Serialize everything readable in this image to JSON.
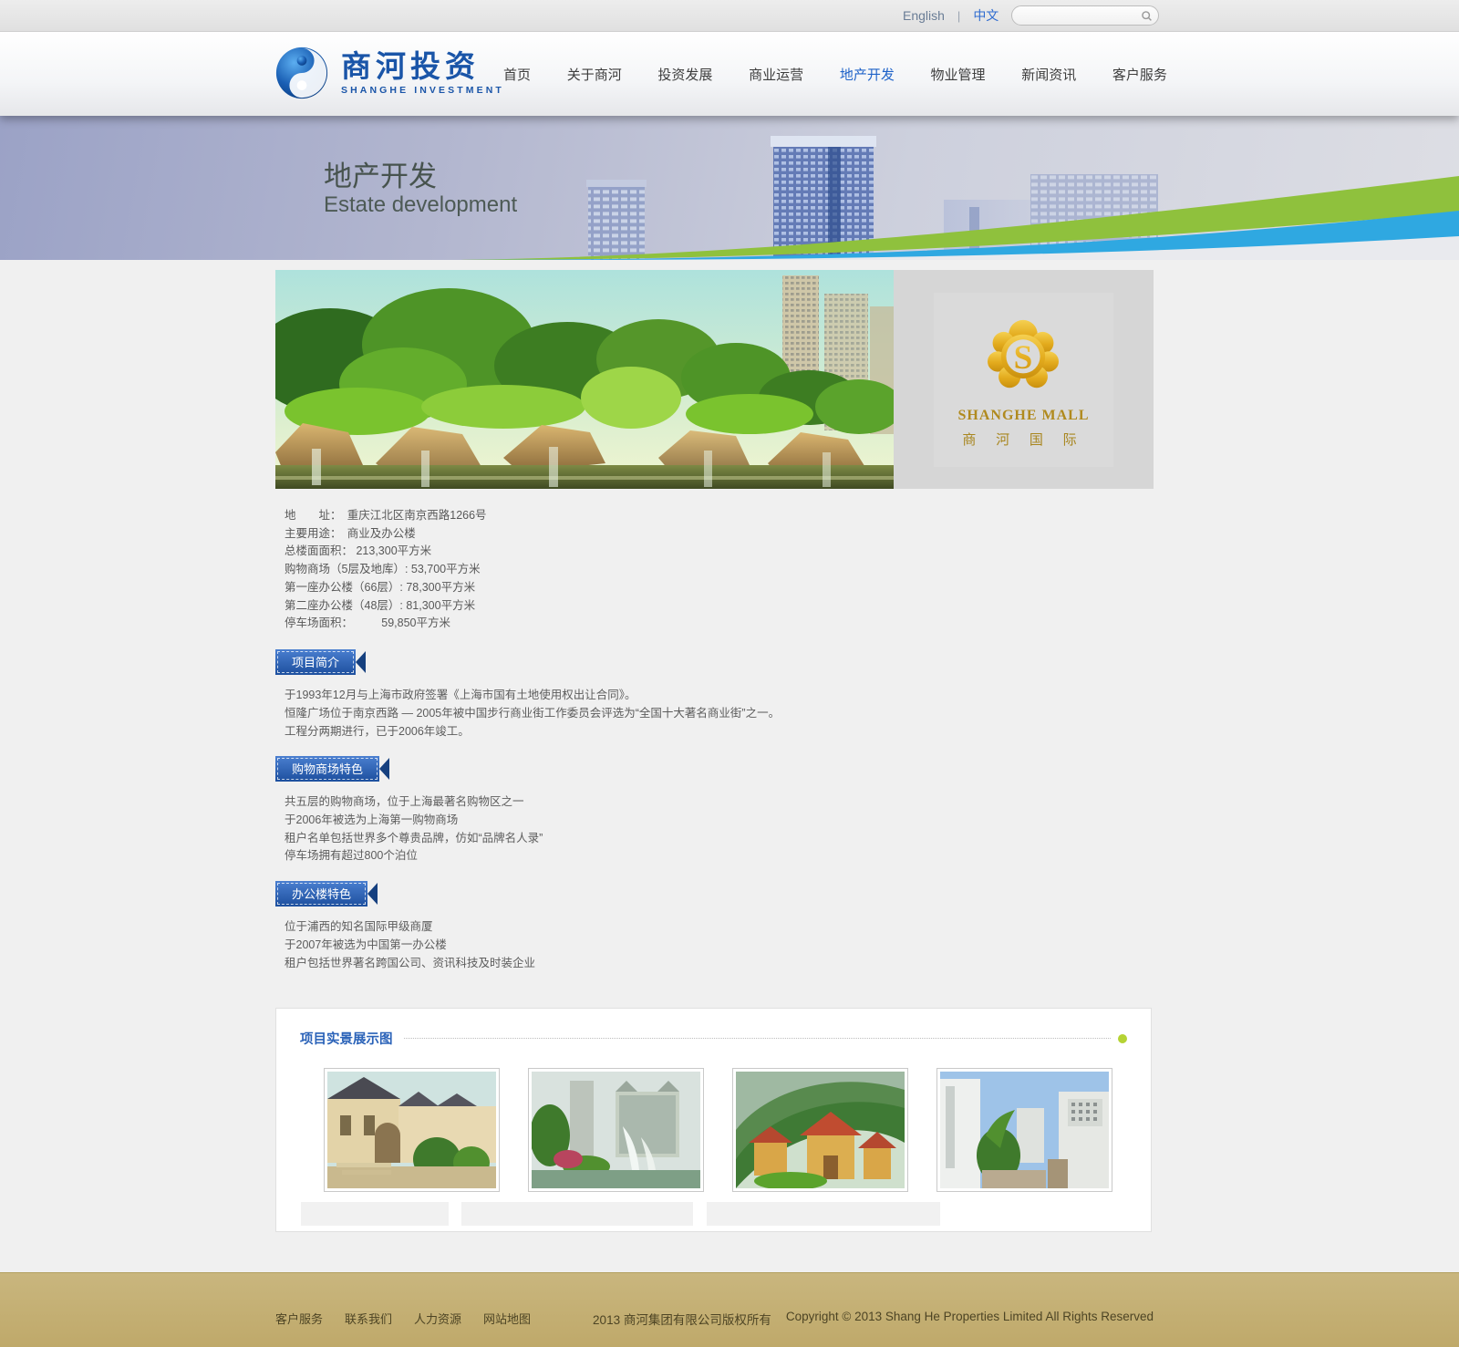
{
  "topbar": {
    "lang_english": "English",
    "lang_divider": "|",
    "lang_chinese": "中文",
    "search_placeholder": ""
  },
  "header": {
    "logo_zh": "商河投资",
    "logo_en": "SHANGHE INVESTMENT",
    "nav": [
      {
        "label": "首页"
      },
      {
        "label": "关于商河"
      },
      {
        "label": "投资发展"
      },
      {
        "label": "商业运营"
      },
      {
        "label": "地产开发",
        "active": true
      },
      {
        "label": "物业管理"
      },
      {
        "label": "新闻资讯"
      },
      {
        "label": "客户服务"
      }
    ]
  },
  "banner": {
    "title_zh": "地产开发",
    "title_en": "Estate development"
  },
  "hero": {
    "mall_letter": "S",
    "mall_name_en": "SHANGHE MALL",
    "mall_name_zh": "商 河 国 际"
  },
  "details": {
    "lines": [
      "地　　址：　重庆江北区南京西路1266号",
      "主要用途：　商业及办公楼",
      "总楼面面积： 213,300平方米",
      "购物商场（5层及地库）: 53,700平方米",
      "第一座办公楼（66层）: 78,300平方米",
      "第二座办公楼（48层）: 81,300平方米",
      "停车场面积：　　　59,850平方米"
    ]
  },
  "sections": [
    {
      "title": "项目简介",
      "lines": [
        "于1993年12月与上海市政府签署《上海市国有土地使用权出让合同》。",
        "恒隆广场位于南京西路 — 2005年被中国步行商业街工作委员会评选为“全国十大著名商业街”之一。",
        "工程分两期进行，已于2006年竣工。"
      ]
    },
    {
      "title": "购物商场特色",
      "lines": [
        "共五层的购物商场，位于上海最著名购物区之一",
        "于2006年被选为上海第一购物商场",
        "租户名单包括世界多个尊贵品牌，仿如“品牌名人录”",
        "停车场拥有超过800个泊位"
      ]
    },
    {
      "title": "办公楼特色",
      "lines": [
        "位于浦西的知名国际甲级商厦",
        "于2007年被选为中国第一办公楼",
        "租户包括世界著名跨国公司、资讯科技及时装企业"
      ]
    }
  ],
  "gallery": {
    "title": "项目实景展示图",
    "photos": [
      "villa-courtyard",
      "residential-fountain",
      "hillside-villas",
      "modern-white-buildings"
    ]
  },
  "footer": {
    "links": [
      {
        "label": "客户服务"
      },
      {
        "label": "联系我们"
      },
      {
        "label": "人力资源"
      },
      {
        "label": "网站地图"
      }
    ],
    "copyright_zh": "2013 商河集团有限公司版权所有",
    "copyright_en": "Copyright © 2013 Shang He Properties Limited  All Rights Reserved"
  },
  "colors": {
    "accent_blue": "#1e62c8",
    "ribbon_blue": "#1d4f9e",
    "gold": "#d89b12",
    "footer_tan": "#c3b078",
    "swoosh_green": "#8fc13d",
    "swoosh_blue": "#2fa8e1",
    "lime_dot": "#b5d334"
  }
}
